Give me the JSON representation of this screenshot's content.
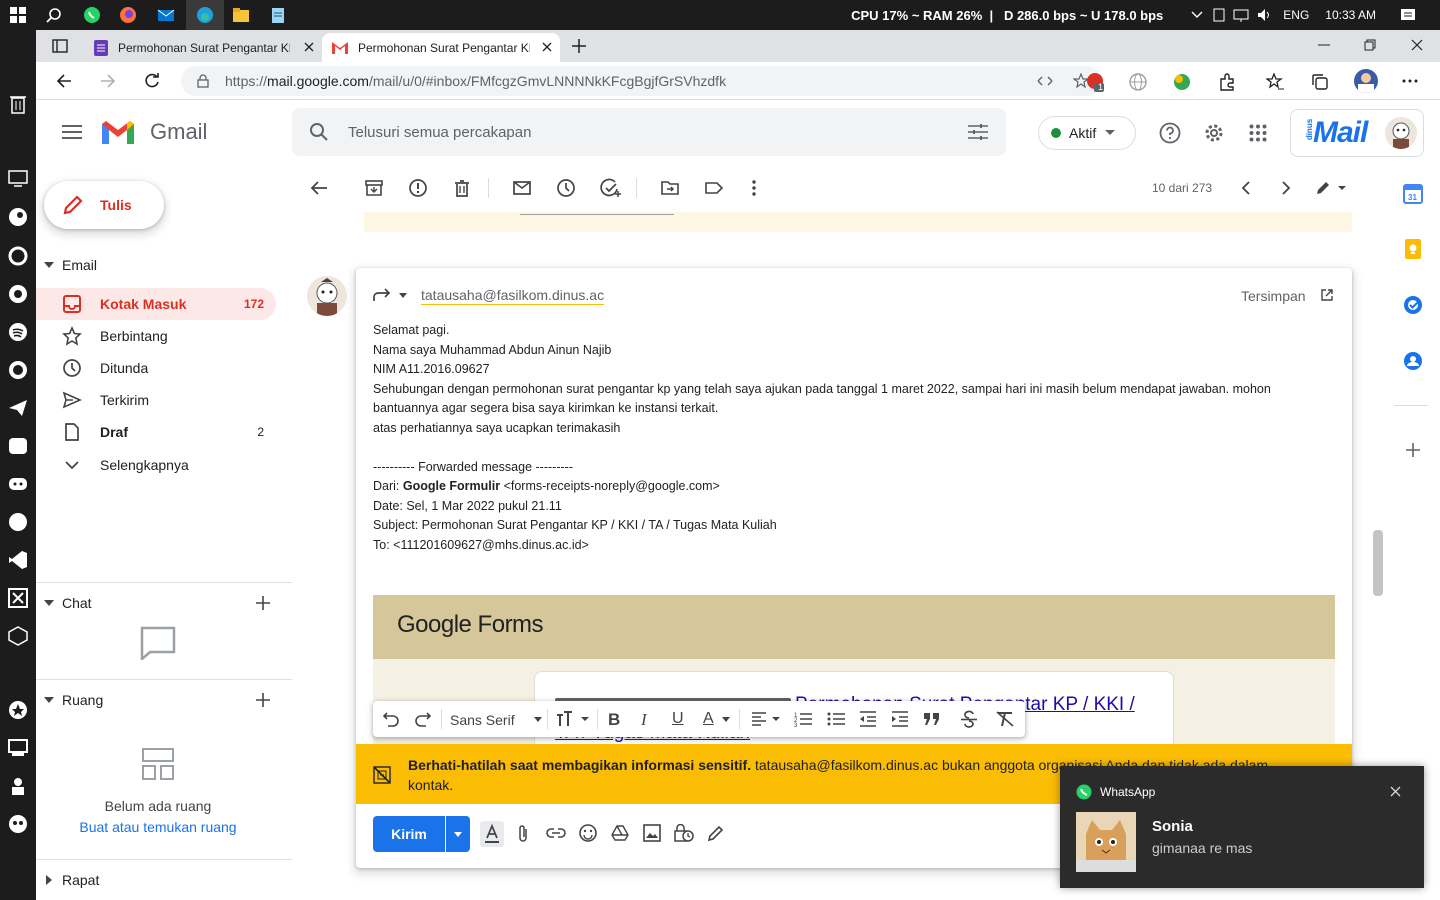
{
  "taskbar": {
    "stats": "CPU 17% ~ RAM 26%  |   D 286.0 bps ~ U 178.0 bps",
    "language": "ENG",
    "time": "10:33 AM"
  },
  "browser": {
    "tabs": [
      {
        "label": "Permohonan Surat Pengantar KP"
      },
      {
        "label": "Permohonan Surat Pengantar KP"
      }
    ],
    "url_prefix": "https://",
    "url_host": "mail.google.com",
    "url_path": "/mail/u/0/#inbox/FMfcgzGmvLNNNNkKFcgBgjfGrSVhzdfk",
    "ext_badge": "1"
  },
  "gmail": {
    "logo_text": "Gmail",
    "search_placeholder": "Telusuri semua percakapan",
    "status": "Aktif",
    "org_logo": "Mail",
    "org_logo_small": "dinus"
  },
  "sidebar": {
    "compose": "Tulis",
    "email_section": "Email",
    "items": [
      {
        "label": "Kotak Masuk",
        "count": "172",
        "icon": "inbox-icon"
      },
      {
        "label": "Berbintang",
        "count": "",
        "icon": "star-icon"
      },
      {
        "label": "Ditunda",
        "count": "",
        "icon": "clock-icon"
      },
      {
        "label": "Terkirim",
        "count": "",
        "icon": "send-icon"
      },
      {
        "label": "Draf",
        "count": "2",
        "icon": "draft-icon"
      },
      {
        "label": "Selengkapnya",
        "count": "",
        "icon": "chevron-down-icon"
      }
    ],
    "chat_section": "Chat",
    "space_section": "Ruang",
    "space_empty": "Belum ada ruang",
    "space_link": "Buat atau temukan ruang",
    "meet_section": "Rapat"
  },
  "toolbar": {
    "pager": "10 dari 273"
  },
  "compose": {
    "recipient": "tatausaha@fasilkom.dinus.ac",
    "saved": "Tersimpan",
    "body": [
      "Selamat pagi.",
      "Nama saya Muhammad Abdun Ainun Najib",
      "NIM A11.2016.09627",
      "Sehubungan dengan permohonan surat pengantar kp yang telah saya ajukan pada tanggal 1 maret 2022, sampai hari ini masih belum mendapat jawaban. mohon",
      "bantuannya agar segera bisa saya kirimkan ke instansi terkait.",
      "atas perhatiannya saya ucapkan terimakasih",
      "",
      "---------- Forwarded message ---------"
    ],
    "from_label": "Dari: ",
    "from_name": "Google Formulir",
    "from_addr": " <forms-receipts-noreply@google.com>",
    "date_line": "Date: Sel, 1 Mar 2022 pukul 21.11",
    "subject_line": "Subject: Permohonan Surat Pengantar KP / KKI / TA / Tugas Mata Kuliah",
    "to_line": "To: <111201609627@mhs.dinus.ac.id>",
    "forms_logo_a": "Google",
    "forms_logo_b": " Forms",
    "link_partial_1": "Permohonan Surat Pengantar KP / KKI /",
    "link_partial_2": "TA / Tugas Mata Kuliah",
    "font_name": "Sans Serif",
    "send": "Kirim",
    "warning_bold": "Berhati-hatilah saat membagikan informasi sensitif.",
    "warning_rest": " tatausaha@fasilkom.dinus.ac bukan anggota organisasi Anda dan tidak ada dalam",
    "warning_line2": "kontak."
  },
  "notification": {
    "app": "WhatsApp",
    "sender": "Sonia",
    "message": "gimanaa re mas"
  },
  "colors": {
    "gmail_red": "#d93025",
    "link_blue": "#1a0dab",
    "send_blue": "#1a73e8",
    "warn_yellow": "#fbbc04",
    "forms_header": "#d6c79a",
    "forms_bg": "#f4f0e4"
  }
}
